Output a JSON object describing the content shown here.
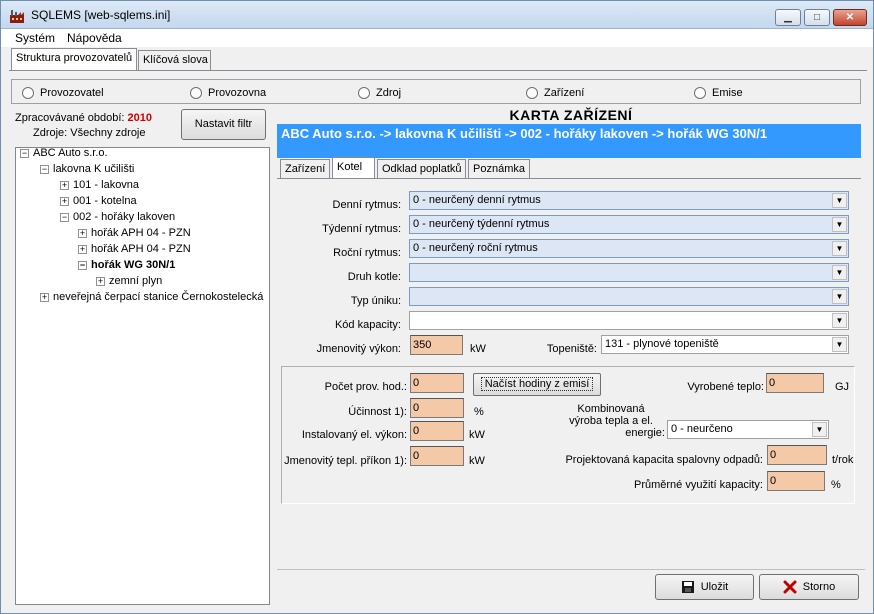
{
  "window": {
    "title": "SQLEMS [web-sqlems.ini]",
    "controls": {
      "minimize": "▁",
      "maximize": "□",
      "close": "✕"
    }
  },
  "menu": [
    "Systém",
    "Nápověda"
  ],
  "top_tabs": [
    "Struktura provozovatelů",
    "Klíčová slova"
  ],
  "radios": [
    "Provozovatel",
    "Provozovna",
    "Zdroj",
    "Zařízení",
    "Emise"
  ],
  "left": {
    "period_label": "Zpracovávané období:",
    "period_value": "2010",
    "sources_label": "Zdroje: Všechny zdroje",
    "filter_button": "Nastavit filtr"
  },
  "tree": [
    "ABC Auto s.r.o.",
    "lakovna K učilišti",
    "101 - lakovna",
    "001 - kotelna",
    "002 - hořáky lakoven",
    "hořák APH 04 - PZN",
    "hořák APH 04 - PZN",
    "hořák  WG 30N/1",
    "zemní plyn",
    "neveřejná čerpací stanice Černokostelecká"
  ],
  "card": {
    "title": "KARTA ZAŘÍZENÍ",
    "path": "ABC Auto s.r.o. -> lakovna K učilišti -> 002 - hořáky lakoven -> hořák  WG 30N/1",
    "tabs": [
      "Zařízení",
      "Kotel",
      "Odklad poplatků",
      "Poznámka"
    ]
  },
  "form": {
    "daily_label": "Denní rytmus:",
    "daily_value": "0 - neurčený denní rytmus",
    "weekly_label": "Týdenní rytmus:",
    "weekly_value": "0 - neurčený týdenní rytmus",
    "yearly_label": "Roční rytmus:",
    "yearly_value": "0 - neurčený roční rytmus",
    "boiler_type_label": "Druh kotle:",
    "leak_type_label": "Typ úniku:",
    "capacity_code_label": "Kód kapacity:",
    "rated_output_label": "Jmenovitý výkon:",
    "rated_output_value": "350",
    "rated_output_unit": "kW",
    "furnace_label": "Topeniště:",
    "furnace_value": "131 - plynové topeniště"
  },
  "calc": {
    "hours_label": "Počet prov. hod.:",
    "hours_value": "0",
    "load_button": "Načíst hodiny z emisí",
    "heat_label": "Vyrobené teplo:",
    "heat_value": "0",
    "heat_unit": "GJ",
    "eff_label": "Účinnost 1):",
    "eff_value": "0",
    "eff_unit": "%",
    "combined_label_1": "Kombinovaná",
    "combined_label_2": "výroba tepla a el.",
    "combined_label_3": "energie:",
    "combined_value": "0 - neurčeno",
    "installed_label": "Instalovaný el. výkon:",
    "installed_value": "0",
    "installed_unit": "kW",
    "rated_input_label": "Jmenovitý tepl. příkon 1):",
    "rated_input_value": "0",
    "rated_input_unit": "kW",
    "incinerator_label": "Projektovaná kapacita spalovny odpadů:",
    "incinerator_value": "0",
    "incinerator_unit": "t/rok",
    "avg_usage_label": "Průměrné využití kapacity:",
    "avg_usage_value": "0",
    "avg_usage_unit": "%"
  },
  "buttons": {
    "save": "Uložit",
    "cancel": "Storno"
  }
}
